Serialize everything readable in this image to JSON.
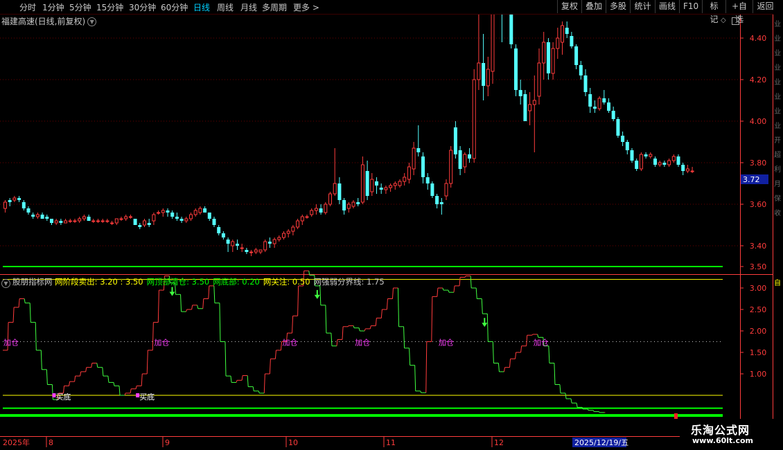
{
  "topbar": {
    "periods": [
      "分时",
      "1分钟",
      "5分钟",
      "15分钟",
      "30分钟",
      "60分钟",
      "日线",
      "周线",
      "月线",
      "多周期",
      "更多 >"
    ],
    "active_period": "日线",
    "buttons": [
      "复权",
      "叠加",
      "多股",
      "统计",
      "画线",
      "F10",
      "标记",
      "+自选",
      "返回"
    ]
  },
  "main": {
    "stock_name": "福建高速(日线,前复权)",
    "price_tag": "3.72"
  },
  "indicator": {
    "name": "股朋指标网",
    "params": [
      {
        "label": "网阶段卖出:",
        "value": "3.20",
        "color": "#ffff00",
        "value2": "3.50"
      },
      {
        "label": "网顶部清仓:",
        "value": "3.50",
        "color": "#00ff00"
      },
      {
        "label": "网底部:",
        "value": "0.20",
        "color": "#00ff00"
      },
      {
        "label": "网关注:",
        "value": "0.50",
        "color": "#ffff00"
      },
      {
        "label": "网强弱分界线:",
        "value": "1.75",
        "color": "#c8c8c8"
      }
    ],
    "add_label": "加仓",
    "buy_label": "买底"
  },
  "date_axis": {
    "labels": [
      "2025年",
      "8",
      "9",
      "10",
      "11",
      "12"
    ],
    "cursor_date": "2025/12/19/五"
  },
  "watermark": {
    "line1": "乐淘公式网",
    "line2": "www.60lt.com"
  },
  "right_strip": [
    "业",
    "业",
    "业",
    "业",
    "业",
    "业",
    "业",
    "业",
    "开",
    "超",
    "利",
    "月",
    "保",
    "收",
    "自"
  ],
  "colors": {
    "up": "#ff3c3c",
    "down": "#54ffff",
    "background": "#000000",
    "axis": "#ff3c3c",
    "grid": "#6a0000"
  },
  "chart_data": [
    {
      "type": "candlestick",
      "title": "福建高速(日线,前复权)",
      "ylim": [
        3.3,
        4.95
      ],
      "yticks": [
        3.4,
        3.6,
        3.8,
        4.0,
        4.2,
        4.4,
        4.6,
        4.8
      ],
      "last_price": 3.72,
      "candles": [
        [
          3.58,
          3.62,
          3.56,
          3.61
        ],
        [
          3.62,
          3.63,
          3.59,
          3.61
        ],
        [
          3.62,
          3.64,
          3.61,
          3.63
        ],
        [
          3.63,
          3.64,
          3.61,
          3.62
        ],
        [
          3.61,
          3.62,
          3.57,
          3.58
        ],
        [
          3.58,
          3.59,
          3.55,
          3.56
        ],
        [
          3.55,
          3.56,
          3.53,
          3.54
        ],
        [
          3.54,
          3.56,
          3.53,
          3.55
        ],
        [
          3.55,
          3.56,
          3.53,
          3.53
        ],
        [
          3.54,
          3.55,
          3.52,
          3.53
        ],
        [
          3.53,
          3.53,
          3.5,
          3.51
        ],
        [
          3.51,
          3.53,
          3.5,
          3.52
        ],
        [
          3.52,
          3.53,
          3.5,
          3.51
        ],
        [
          3.51,
          3.53,
          3.51,
          3.52
        ],
        [
          3.52,
          3.53,
          3.51,
          3.52
        ],
        [
          3.52,
          3.53,
          3.51,
          3.52
        ],
        [
          3.52,
          3.54,
          3.51,
          3.53
        ],
        [
          3.53,
          3.55,
          3.52,
          3.54
        ],
        [
          3.54,
          3.55,
          3.52,
          3.52
        ],
        [
          3.52,
          3.53,
          3.51,
          3.52
        ],
        [
          3.52,
          3.53,
          3.51,
          3.52
        ],
        [
          3.52,
          3.53,
          3.51,
          3.52
        ],
        [
          3.52,
          3.53,
          3.51,
          3.52
        ],
        [
          3.51,
          3.52,
          3.5,
          3.51
        ],
        [
          3.51,
          3.53,
          3.5,
          3.53
        ],
        [
          3.53,
          3.54,
          3.52,
          3.53
        ],
        [
          3.53,
          3.55,
          3.52,
          3.54
        ],
        [
          3.54,
          3.55,
          3.53,
          3.54
        ],
        [
          3.53,
          3.53,
          3.5,
          3.5
        ],
        [
          3.5,
          3.51,
          3.48,
          3.49
        ],
        [
          3.5,
          3.53,
          3.49,
          3.52
        ],
        [
          3.51,
          3.53,
          3.49,
          3.5
        ],
        [
          3.52,
          3.56,
          3.5,
          3.55
        ],
        [
          3.56,
          3.57,
          3.55,
          3.56
        ],
        [
          3.56,
          3.58,
          3.54,
          3.57
        ],
        [
          3.57,
          3.58,
          3.54,
          3.56
        ],
        [
          3.56,
          3.57,
          3.53,
          3.54
        ],
        [
          3.54,
          3.56,
          3.52,
          3.53
        ],
        [
          3.53,
          3.54,
          3.51,
          3.52
        ],
        [
          3.52,
          3.54,
          3.51,
          3.53
        ],
        [
          3.53,
          3.56,
          3.52,
          3.55
        ],
        [
          3.55,
          3.58,
          3.54,
          3.57
        ],
        [
          3.56,
          3.59,
          3.55,
          3.58
        ],
        [
          3.58,
          3.59,
          3.56,
          3.56
        ],
        [
          3.56,
          3.56,
          3.52,
          3.53
        ],
        [
          3.53,
          3.54,
          3.49,
          3.5
        ],
        [
          3.49,
          3.5,
          3.45,
          3.46
        ],
        [
          3.46,
          3.47,
          3.43,
          3.44
        ],
        [
          3.43,
          3.44,
          3.37,
          3.41
        ],
        [
          3.4,
          3.43,
          3.37,
          3.42
        ],
        [
          3.41,
          3.43,
          3.38,
          3.4
        ],
        [
          3.39,
          3.41,
          3.37,
          3.39
        ],
        [
          3.38,
          3.39,
          3.36,
          3.37
        ],
        [
          3.37,
          3.38,
          3.35,
          3.37
        ],
        [
          3.37,
          3.39,
          3.36,
          3.38
        ],
        [
          3.37,
          3.38,
          3.36,
          3.38
        ],
        [
          3.38,
          3.43,
          3.37,
          3.42
        ],
        [
          3.42,
          3.44,
          3.39,
          3.41
        ],
        [
          3.41,
          3.44,
          3.39,
          3.43
        ],
        [
          3.43,
          3.45,
          3.42,
          3.44
        ],
        [
          3.44,
          3.47,
          3.43,
          3.46
        ],
        [
          3.46,
          3.48,
          3.44,
          3.47
        ],
        [
          3.47,
          3.5,
          3.45,
          3.49
        ],
        [
          3.49,
          3.53,
          3.48,
          3.52
        ],
        [
          3.52,
          3.55,
          3.5,
          3.54
        ],
        [
          3.54,
          3.55,
          3.53,
          3.54
        ],
        [
          3.55,
          3.58,
          3.54,
          3.57
        ],
        [
          3.57,
          3.6,
          3.55,
          3.58
        ],
        [
          3.58,
          3.6,
          3.55,
          3.56
        ],
        [
          3.56,
          3.61,
          3.55,
          3.6
        ],
        [
          3.6,
          3.66,
          3.59,
          3.65
        ],
        [
          3.65,
          3.87,
          3.64,
          3.7
        ],
        [
          3.7,
          3.73,
          3.6,
          3.62
        ],
        [
          3.62,
          3.63,
          3.55,
          3.57
        ],
        [
          3.58,
          3.61,
          3.56,
          3.6
        ],
        [
          3.59,
          3.62,
          3.58,
          3.61
        ],
        [
          3.61,
          3.63,
          3.59,
          3.6
        ],
        [
          3.61,
          3.83,
          3.6,
          3.79
        ],
        [
          3.76,
          3.81,
          3.62,
          3.64
        ],
        [
          3.66,
          3.75,
          3.64,
          3.72
        ],
        [
          3.71,
          3.73,
          3.65,
          3.69
        ],
        [
          3.68,
          3.7,
          3.65,
          3.67
        ],
        [
          3.67,
          3.69,
          3.65,
          3.68
        ],
        [
          3.68,
          3.7,
          3.66,
          3.69
        ],
        [
          3.69,
          3.71,
          3.67,
          3.7
        ],
        [
          3.69,
          3.72,
          3.68,
          3.71
        ],
        [
          3.71,
          3.75,
          3.69,
          3.73
        ],
        [
          3.72,
          3.8,
          3.7,
          3.78
        ],
        [
          3.77,
          3.9,
          3.74,
          3.87
        ],
        [
          3.87,
          3.98,
          3.83,
          3.85
        ],
        [
          3.83,
          3.85,
          3.7,
          3.73
        ],
        [
          3.73,
          3.75,
          3.67,
          3.7
        ],
        [
          3.7,
          3.71,
          3.63,
          3.64
        ],
        [
          3.64,
          3.65,
          3.58,
          3.6
        ],
        [
          3.61,
          3.63,
          3.55,
          3.6
        ],
        [
          3.64,
          3.72,
          3.62,
          3.7
        ],
        [
          3.7,
          3.88,
          3.68,
          3.86
        ],
        [
          3.97,
          4.0,
          3.82,
          3.84
        ],
        [
          3.86,
          3.88,
          3.74,
          3.77
        ],
        [
          3.78,
          3.85,
          3.75,
          3.84
        ],
        [
          3.84,
          3.87,
          3.8,
          3.82
        ],
        [
          3.82,
          4.25,
          3.8,
          4.2
        ],
        [
          4.2,
          4.62,
          4.15,
          4.28
        ],
        [
          4.28,
          4.42,
          4.1,
          4.17
        ],
        [
          4.17,
          4.31,
          4.12,
          4.25
        ],
        [
          4.24,
          4.86,
          4.18,
          4.6
        ],
        [
          4.6,
          4.94,
          4.55,
          4.72
        ],
        [
          4.72,
          4.8,
          4.38,
          4.58
        ],
        [
          4.6,
          4.88,
          4.58,
          4.66
        ],
        [
          4.66,
          4.73,
          4.35,
          4.37
        ],
        [
          4.35,
          4.37,
          4.12,
          4.15
        ],
        [
          4.15,
          4.2,
          4.08,
          4.12
        ],
        [
          4.13,
          4.15,
          4.0,
          4.0
        ],
        [
          4.05,
          4.14,
          3.98,
          4.08
        ],
        [
          4.08,
          4.22,
          3.85,
          4.1
        ],
        [
          4.12,
          4.35,
          4.08,
          4.28
        ],
        [
          4.28,
          4.43,
          4.2,
          4.38
        ],
        [
          4.38,
          4.4,
          4.2,
          4.23
        ],
        [
          4.23,
          4.38,
          4.2,
          4.35
        ],
        [
          4.35,
          4.45,
          4.3,
          4.4
        ],
        [
          4.38,
          4.48,
          4.32,
          4.46
        ],
        [
          4.45,
          4.48,
          4.4,
          4.42
        ],
        [
          4.41,
          4.43,
          4.35,
          4.36
        ],
        [
          4.36,
          4.37,
          4.25,
          4.27
        ],
        [
          4.27,
          4.29,
          4.2,
          4.22
        ],
        [
          4.22,
          4.25,
          4.12,
          4.14
        ],
        [
          4.13,
          4.16,
          4.04,
          4.07
        ],
        [
          4.07,
          4.1,
          4.04,
          4.06
        ],
        [
          4.06,
          4.12,
          4.05,
          4.11
        ],
        [
          4.11,
          4.15,
          4.08,
          4.09
        ],
        [
          4.09,
          4.11,
          4.04,
          4.05
        ],
        [
          4.05,
          4.07,
          4.0,
          4.01
        ],
        [
          4.01,
          4.02,
          3.92,
          3.93
        ],
        [
          3.93,
          3.95,
          3.88,
          3.9
        ],
        [
          3.9,
          3.91,
          3.84,
          3.86
        ],
        [
          3.86,
          3.87,
          3.8,
          3.81
        ],
        [
          3.81,
          3.82,
          3.76,
          3.77
        ],
        [
          3.77,
          3.85,
          3.76,
          3.84
        ],
        [
          3.84,
          3.85,
          3.82,
          3.83
        ],
        [
          3.83,
          3.85,
          3.82,
          3.84
        ],
        [
          3.82,
          3.83,
          3.78,
          3.79
        ],
        [
          3.79,
          3.81,
          3.78,
          3.8
        ],
        [
          3.8,
          3.81,
          3.78,
          3.79
        ],
        [
          3.79,
          3.82,
          3.78,
          3.81
        ],
        [
          3.81,
          3.84,
          3.8,
          3.83
        ],
        [
          3.83,
          3.84,
          3.78,
          3.79
        ],
        [
          3.79,
          3.8,
          3.74,
          3.76
        ],
        [
          3.76,
          3.79,
          3.75,
          3.77
        ],
        [
          3.76,
          3.78,
          3.75,
          3.76
        ]
      ]
    },
    {
      "type": "line",
      "title": "股朋指标网",
      "ylim": [
        0.0,
        3.75
      ],
      "yticks": [
        1.0,
        1.5,
        2.0,
        2.5,
        3.0,
        3.5
      ],
      "levels": [
        {
          "name": "网顶部清仓",
          "value": 3.5,
          "color": "#00ff00"
        },
        {
          "name": "网阶段卖出",
          "value": 3.2,
          "color": "#ffff00"
        },
        {
          "name": "网强弱分界线",
          "value": 1.75,
          "color": "#c8c8c8"
        },
        {
          "name": "网关注",
          "value": 0.5,
          "color": "#ffff00"
        },
        {
          "name": "网底部",
          "value": 0.2,
          "color": "#00ff00"
        }
      ],
      "values": [
        1.55,
        2.2,
        2.55,
        2.75,
        2.65,
        2.2,
        1.55,
        1.1,
        0.75,
        0.4,
        0.55,
        0.72,
        0.82,
        0.95,
        1.05,
        1.15,
        1.25,
        1.15,
        0.95,
        0.8,
        0.72,
        0.5,
        0.55,
        0.65,
        0.72,
        1.0,
        1.55,
        2.2,
        2.95,
        3.28,
        3.12,
        2.85,
        2.45,
        2.5,
        2.6,
        2.52,
        2.75,
        3.05,
        2.65,
        1.75,
        0.95,
        0.8,
        0.85,
        0.96,
        0.7,
        0.6,
        0.55,
        1.0,
        1.35,
        1.55,
        1.75,
        1.95,
        2.35,
        3.05,
        3.4,
        3.3,
        3.05,
        2.6,
        1.95,
        1.65,
        1.8,
        2.1,
        2.12,
        2.07,
        2.0,
        2.05,
        2.12,
        2.3,
        2.5,
        2.75,
        3.0,
        2.1,
        1.6,
        1.2,
        0.6,
        0.56,
        1.75,
        2.8,
        3.0,
        2.95,
        2.9,
        3.05,
        3.25,
        3.28,
        3.0,
        2.75,
        2.4,
        1.75,
        1.25,
        1.05,
        1.15,
        1.35,
        1.5,
        1.65,
        1.9,
        1.92,
        1.85,
        1.65,
        1.25,
        0.75,
        0.55,
        0.42,
        0.32,
        0.22,
        0.18,
        0.15,
        0.12,
        0.1
      ],
      "buy_points": [
        9,
        24
      ],
      "add_points": [
        0,
        27,
        50,
        63,
        78,
        95
      ],
      "sell_arrows": [
        30,
        56,
        86
      ]
    }
  ]
}
